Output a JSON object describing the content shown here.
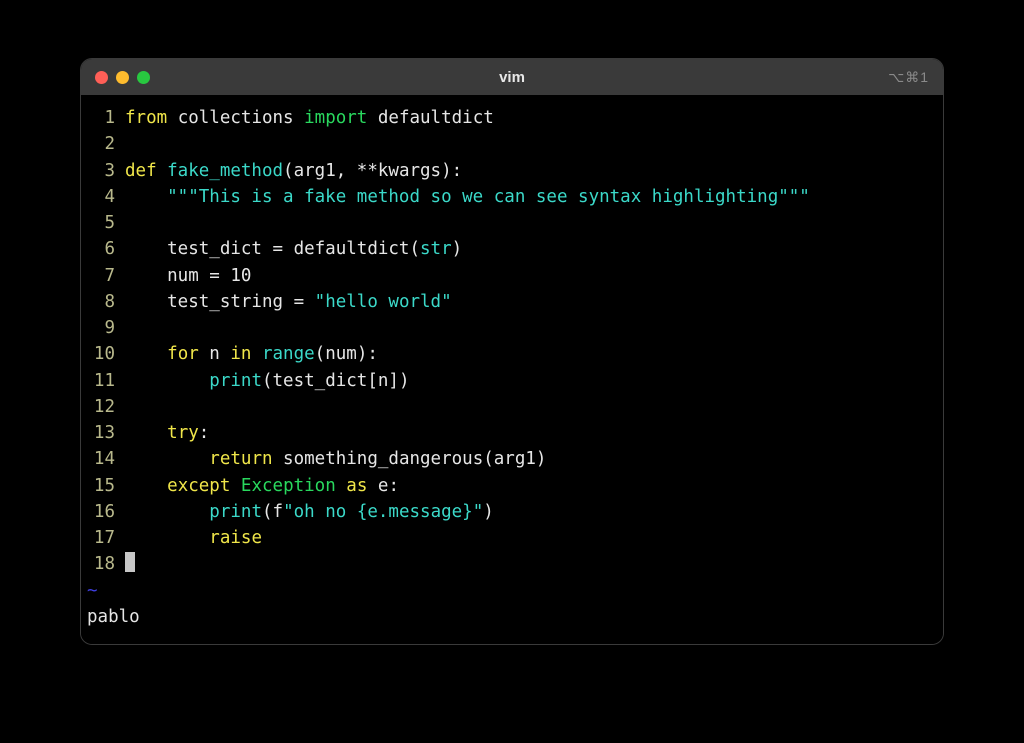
{
  "window": {
    "title": "vim",
    "badge": "⌥⌘1"
  },
  "traffic_lights": {
    "close": "#ff5f57",
    "minimize": "#febc2e",
    "zoom": "#28c840"
  },
  "gutter": {
    "1": "1",
    "2": "2",
    "3": "3",
    "4": "4",
    "5": "5",
    "6": "6",
    "7": "7",
    "8": "8",
    "9": "9",
    "10": "10",
    "11": "11",
    "12": "12",
    "13": "13",
    "14": "14",
    "15": "15",
    "16": "16",
    "17": "17",
    "18": "18"
  },
  "code": {
    "l1": {
      "from": "from",
      "mod": " collections ",
      "import": "import",
      "name": " defaultdict"
    },
    "l3": {
      "def": "def",
      "fn": " fake_method",
      "args": "(arg1, **kwargs):"
    },
    "l4_doc": "    \"\"\"This is a fake method so we can see syntax highlighting\"\"\"",
    "l6": {
      "pre": "    test_dict = defaultdict(",
      "type": "str",
      "post": ")"
    },
    "l7": {
      "pre": "    num = ",
      "num": "10"
    },
    "l8": {
      "pre": "    test_string = ",
      "str": "\"hello world\""
    },
    "l10": {
      "for": "for",
      "mid": " n ",
      "in": "in",
      "call": " range",
      "post": "(num):"
    },
    "l11": {
      "indent": "        ",
      "print": "print",
      "post": "(test_dict[n])"
    },
    "l13": {
      "indent": "    ",
      "try": "try",
      "colon": ":"
    },
    "l14": {
      "indent": "        ",
      "return": "return",
      "post": " something_dangerous(arg1)"
    },
    "l15": {
      "indent": "    ",
      "except": "except",
      "sp1": " ",
      "exc": "Exception",
      "sp2": " ",
      "as": "as",
      "post": " e:"
    },
    "l16": {
      "indent": "        ",
      "print": "print",
      "open": "(f",
      "str": "\"oh no {e.message}\"",
      "close": ")"
    },
    "l17": {
      "indent": "        ",
      "raise": "raise"
    }
  },
  "tilde": "~",
  "status": "pablo",
  "colors": {
    "keyword": "#f0e64a",
    "import": "#29d85e",
    "builtin": "#3bd9c9",
    "string": "#3bd9c9",
    "exception": "#29d85e",
    "gutter": "#b9b98c",
    "tilde": "#3e3ee0",
    "bg": "#000000"
  }
}
